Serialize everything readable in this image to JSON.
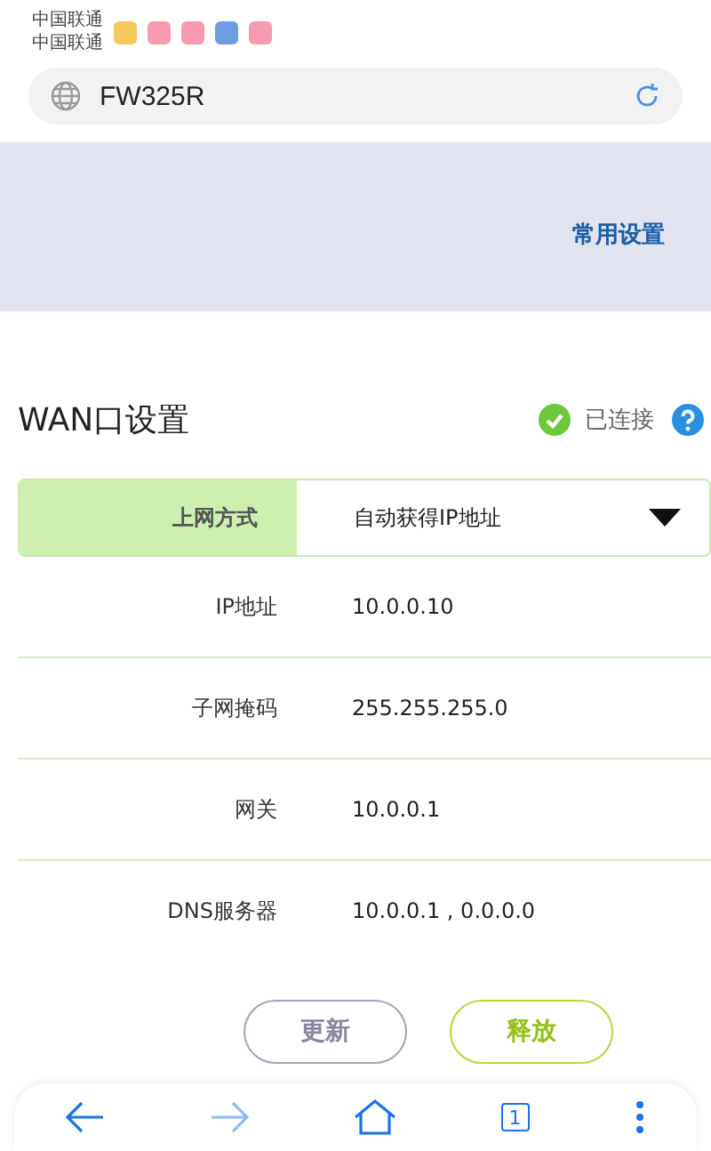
{
  "status_bar": {
    "carriers": [
      "中国联通",
      "中国联通"
    ]
  },
  "address_bar": {
    "value": "FW325R"
  },
  "header": {
    "link": "常用设置"
  },
  "section": {
    "title": "WAN口设置",
    "status": "已连接",
    "connected": true
  },
  "connection_type": {
    "label": "上网方式",
    "value": "自动获得IP地址"
  },
  "fields": [
    {
      "label": "IP地址",
      "value": "10.0.0.10"
    },
    {
      "label": "子网掩码",
      "value": "255.255.255.0"
    },
    {
      "label": "网关",
      "value": "10.0.0.1"
    },
    {
      "label": "DNS服务器",
      "value": "10.0.0.1 , 0.0.0.0"
    }
  ],
  "buttons": [
    {
      "label": "更新",
      "kind": "secondary"
    },
    {
      "label": "释放",
      "kind": "primary"
    }
  ],
  "nav": {
    "tab_count": "1"
  }
}
